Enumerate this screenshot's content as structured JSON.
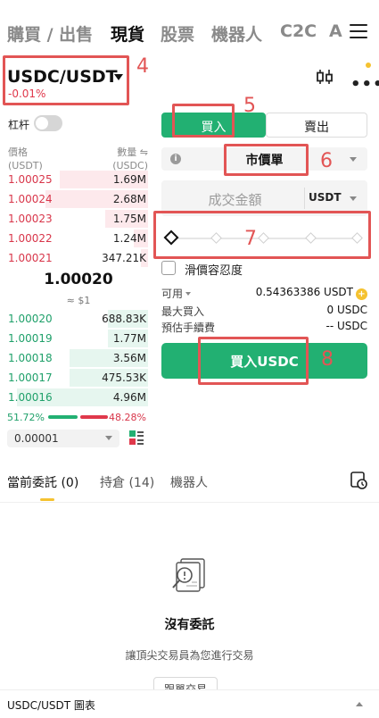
{
  "nav": {
    "tabs": [
      {
        "label": "購買 / 出售",
        "active": false
      },
      {
        "label": "現貨",
        "active": true
      },
      {
        "label": "股票",
        "active": false
      },
      {
        "label": "機器人",
        "active": false
      },
      {
        "label": "C2C",
        "active": false
      },
      {
        "label": "A",
        "active": false
      }
    ]
  },
  "pair": {
    "name": "USDC/USDT",
    "change": "-0.01%"
  },
  "leverage": {
    "label": "杠杆",
    "enabled": false
  },
  "orderbook": {
    "price_header": "價格",
    "price_unit": "(USDT)",
    "qty_header": "數量 ⇋",
    "qty_unit": "(USDC)",
    "asks": [
      {
        "price": "1.00025",
        "qty": "1.69M",
        "depth": 0.62
      },
      {
        "price": "1.00024",
        "qty": "2.68M",
        "depth": 0.72
      },
      {
        "price": "1.00023",
        "qty": "1.75M",
        "depth": 0.3
      },
      {
        "price": "1.00022",
        "qty": "1.24M",
        "depth": 0.1
      },
      {
        "price": "1.00021",
        "qty": "347.21K",
        "depth": 0.05
      }
    ],
    "mid_price": "1.00020",
    "mid_usd": "≈ $1",
    "bids": [
      {
        "price": "1.00020",
        "qty": "688.83K",
        "depth": 0.28
      },
      {
        "price": "1.00019",
        "qty": "1.77M",
        "depth": 0.28
      },
      {
        "price": "1.00018",
        "qty": "3.56M",
        "depth": 0.55
      },
      {
        "price": "1.00017",
        "qty": "475.53K",
        "depth": 0.55
      },
      {
        "price": "1.00016",
        "qty": "4.96M",
        "depth": 0.92
      }
    ],
    "buy_ratio": "51.72%",
    "sell_ratio": "48.28%",
    "buy_ratio_value": 0.5172,
    "step": "0.00001"
  },
  "order_form": {
    "buy_label": "買入",
    "sell_label": "賣出",
    "order_type": "市價單",
    "amount_placeholder": "成交金額",
    "amount_unit": "USDT",
    "slippage_label": "滑價容忍度",
    "available_label": "可用",
    "available_value": "0.54363386 USDT",
    "max_buy_label": "最大買入",
    "max_buy_value": "0 USDC",
    "fee_label": "預估手續費",
    "fee_value": "-- USDC",
    "submit_label": "買入USDC"
  },
  "annotations": [
    "4",
    "5",
    "6",
    "7",
    "8"
  ],
  "bottom": {
    "tabs": [
      {
        "label": "當前委託",
        "count": "(0)",
        "active": true
      },
      {
        "label": "持倉",
        "count": "(14)",
        "active": false
      },
      {
        "label": "機器人",
        "count": "",
        "active": false
      }
    ],
    "empty_title": "沒有委託",
    "empty_subtitle": "讓頂尖交易員為您進行交易",
    "copy_button": "跟單交易",
    "chart_label": "USDC/USDT 圖表"
  },
  "colors": {
    "buy": "#22b072",
    "sell": "#e0384b",
    "annotation": "#e25555",
    "accent": "#f5c230"
  }
}
